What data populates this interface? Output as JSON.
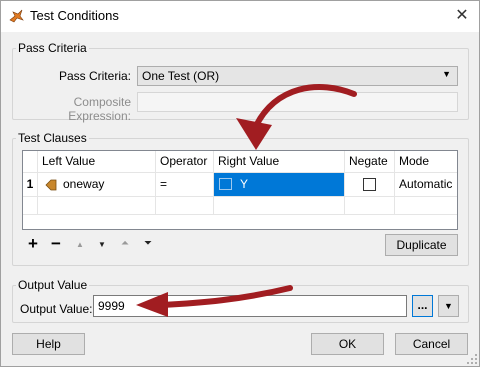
{
  "window": {
    "title": "Test Conditions"
  },
  "pass_criteria": {
    "group_title": "Pass Criteria",
    "label": "Pass Criteria:",
    "value": "One Test (OR)",
    "composite_label": "Composite Expression:",
    "composite_value": ""
  },
  "test_clauses": {
    "group_title": "Test Clauses",
    "columns": [
      "Left Value",
      "Operator",
      "Right Value",
      "Negate",
      "Mode"
    ],
    "rows": [
      {
        "num": "1",
        "left": "oneway",
        "operator": "=",
        "right": "Y",
        "negate": false,
        "mode": "Automatic"
      }
    ],
    "toolbar": {
      "add": "+",
      "remove": "−",
      "up": "▲",
      "down": "▼",
      "top": "⏶",
      "bottom": "⏷"
    },
    "duplicate_label": "Duplicate"
  },
  "output": {
    "group_title": "Output Value",
    "label": "Output Value:",
    "value": "9999",
    "browse_label": "..."
  },
  "buttons": {
    "help": "Help",
    "ok": "OK",
    "cancel": "Cancel"
  },
  "colors": {
    "selection": "#0078d7",
    "annotation_arrow": "#a11d21",
    "attribute_icon": "#c8872d"
  }
}
